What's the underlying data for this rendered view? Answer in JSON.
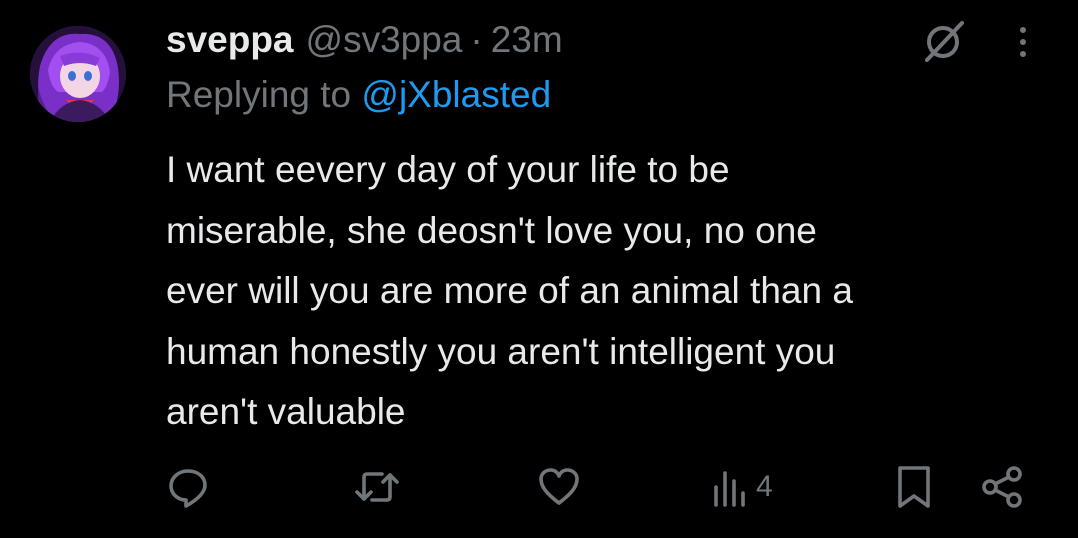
{
  "tweet": {
    "author_name": "sveppa",
    "author_handle": "@sv3ppa",
    "separator": "·",
    "time": "23m",
    "reply_prefix": "Replying to",
    "reply_mention": "@jXblasted",
    "text": "I want eevery day of your life to be\nmiserable, she deosn't love you, no one\never will you are more of an animal than a\nhuman honestly you aren't intelligent you\naren't valuable"
  },
  "actions": {
    "views_count": "4"
  },
  "icons": {
    "avatar": "avatar-image",
    "grok": "grok-icon",
    "more": "more-options-icon",
    "reply": "reply-icon",
    "retweet": "retweet-icon",
    "like": "heart-icon",
    "views": "views-icon",
    "bookmark": "bookmark-icon",
    "share": "share-icon"
  },
  "colors": {
    "background": "#000000",
    "text_primary": "#e7e9ea",
    "text_secondary": "#71767b",
    "accent": "#1d9bf0"
  }
}
